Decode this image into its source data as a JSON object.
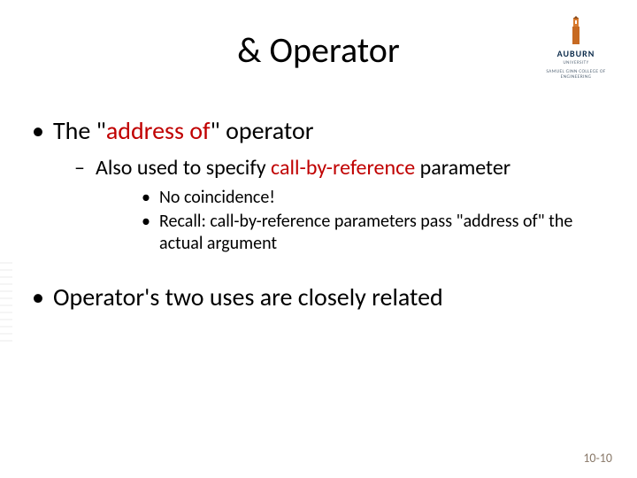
{
  "title": "& Operator",
  "logo": {
    "main": "AUBURN",
    "sub": "UNIVERSITY",
    "college": "SAMUEL GINN COLLEGE OF ENGINEERING"
  },
  "bullets": {
    "b1_pre": "The \"",
    "b1_red": "address of",
    "b1_post": "\" operator",
    "b1_1_pre": "Also used to specify ",
    "b1_1_red": "call-by-reference",
    "b1_1_post": " parameter",
    "b1_1_1": "No coincidence!",
    "b1_1_2": "Recall: call-by-reference parameters pass \"address of\" the actual argument",
    "b2": "Operator's two uses are closely related"
  },
  "page_number": "10-10"
}
